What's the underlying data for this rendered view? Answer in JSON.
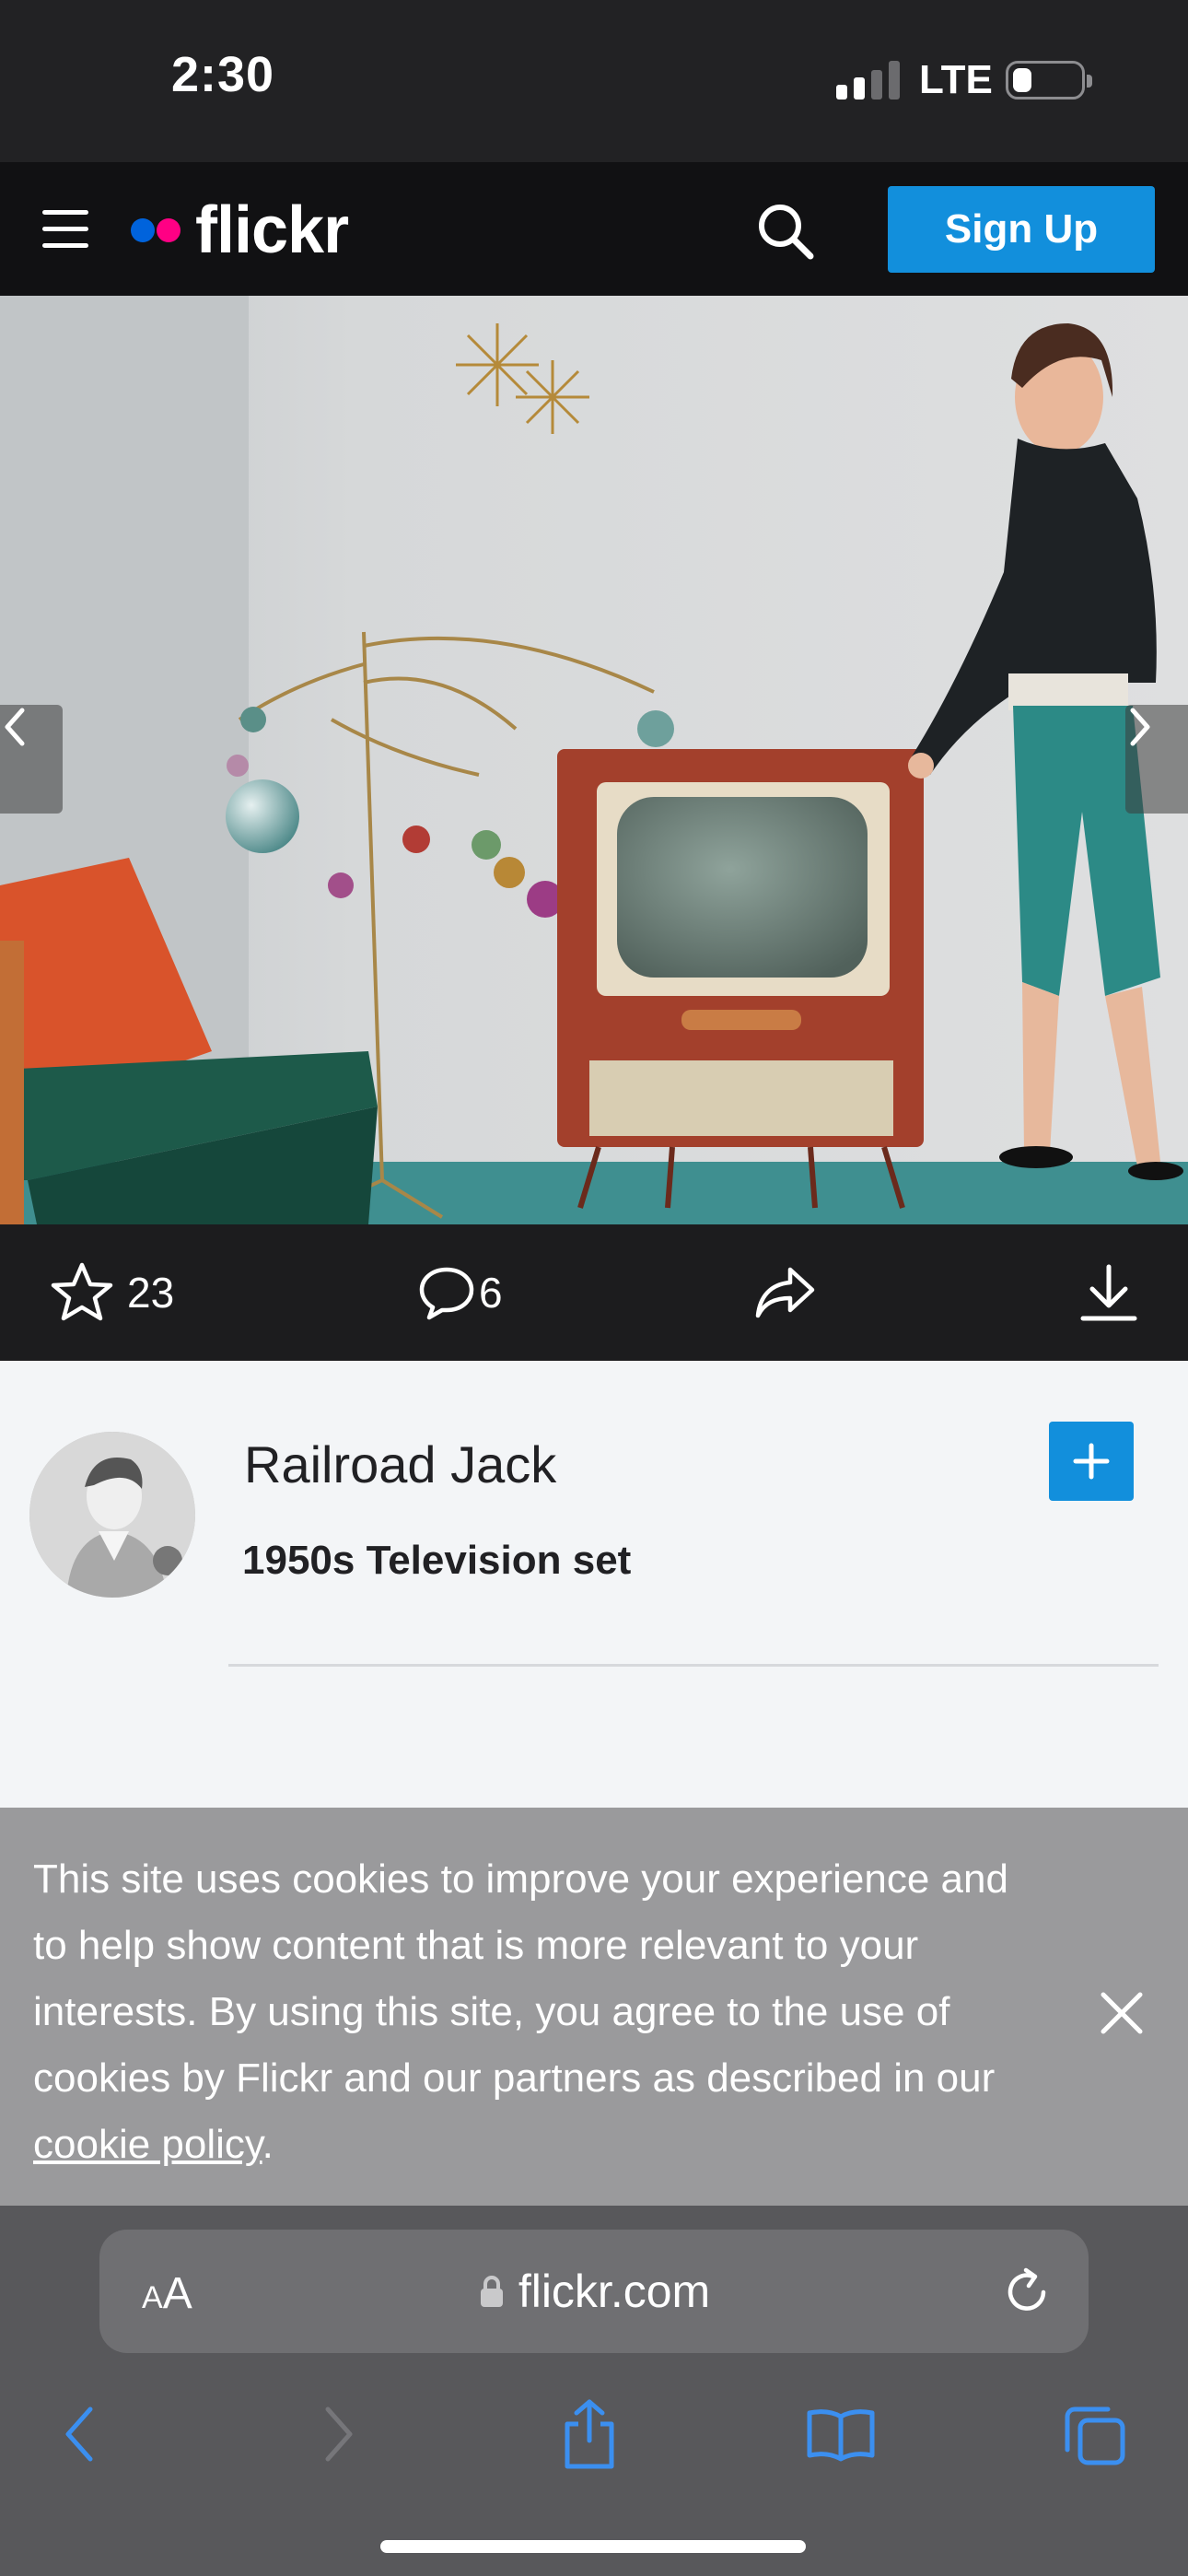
{
  "status_bar": {
    "time": "2:30",
    "network": "LTE",
    "signal_bars_active": 2,
    "signal_bars_total": 4
  },
  "header": {
    "logo_text": "flickr",
    "logo_colors": [
      "#0063dc",
      "#ff0084"
    ],
    "signup_label": "Sign Up",
    "accent_color": "#128fdc"
  },
  "photo": {
    "icons": [
      "chevron-left-icon",
      "chevron-right-icon"
    ]
  },
  "actions": {
    "favorites_count": "23",
    "comments_count": "6",
    "icons": [
      "star-icon",
      "comment-icon",
      "share-icon",
      "download-icon"
    ]
  },
  "content": {
    "owner_name": "Railroad Jack",
    "photo_title": "1950s Television set",
    "add_icon": "plus-icon"
  },
  "cookie_banner": {
    "text_before_link": "This site uses cookies to improve your experience and to help show content that is more relevant to your interests. By using this site, you agree to the use of cookies by Flickr and our partners as described in our ",
    "link_text": "cookie policy",
    "text_after_link": "."
  },
  "browser": {
    "text_size_label_small": "A",
    "text_size_label_large": "A",
    "url": "flickr.com",
    "toolbar_icons": [
      "back-icon",
      "forward-icon",
      "share-icon",
      "bookmarks-icon",
      "tabs-icon"
    ]
  }
}
